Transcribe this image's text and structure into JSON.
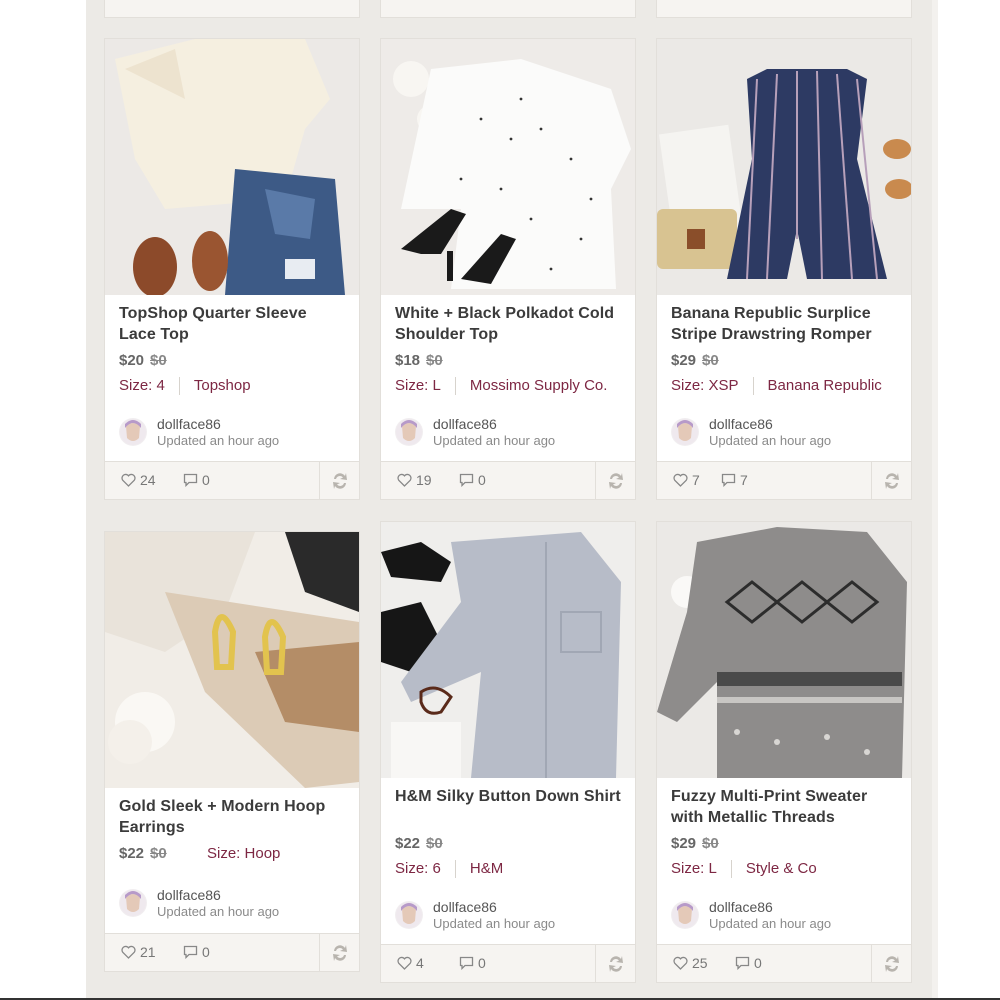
{
  "cards": [
    {
      "title": "TopShop Quarter Sleeve Lace Top",
      "price": "$20",
      "original_price": "$0",
      "size": "Size: 4",
      "brand": "Topshop",
      "user": "dollface86",
      "updated": "Updated an hour ago",
      "likes": "24",
      "comments": "0"
    },
    {
      "title": "White + Black Polkadot Cold Shoulder Top",
      "price": "$18",
      "original_price": "$0",
      "size": "Size: L",
      "brand": "Mossimo Supply Co.",
      "user": "dollface86",
      "updated": "Updated an hour ago",
      "likes": "19",
      "comments": "0"
    },
    {
      "title": "Banana Republic Surplice Stripe Drawstring Romper",
      "price": "$29",
      "original_price": "$0",
      "size": "Size: XSP",
      "brand": "Banana Republic",
      "user": "dollface86",
      "updated": "Updated an hour ago",
      "likes": "7",
      "comments": "7"
    },
    {
      "title": "Gold Sleek + Modern Hoop Earrings",
      "price": "$22",
      "original_price": "$0",
      "size": "Size: Hoop",
      "brand": "",
      "user": "dollface86",
      "updated": "Updated an hour ago",
      "likes": "21",
      "comments": "0"
    },
    {
      "title": "H&M Silky Button Down Shirt",
      "price": "$22",
      "original_price": "$0",
      "size": "Size: 6",
      "brand": "H&M",
      "user": "dollface86",
      "updated": "Updated an hour ago",
      "likes": "4",
      "comments": "0"
    },
    {
      "title": "Fuzzy Multi-Print Sweater with Metallic Threads",
      "price": "$29",
      "original_price": "$0",
      "size": "Size: L",
      "brand": "Style & Co",
      "user": "dollface86",
      "updated": "Updated an hour ago",
      "likes": "25",
      "comments": "0"
    }
  ],
  "icons": {
    "like": "heart-outline-icon",
    "comment": "speech-bubble-icon",
    "share": "share-arrows-icon"
  },
  "colors": {
    "brand_accent": "#7d2743",
    "background": "#eceae6"
  }
}
